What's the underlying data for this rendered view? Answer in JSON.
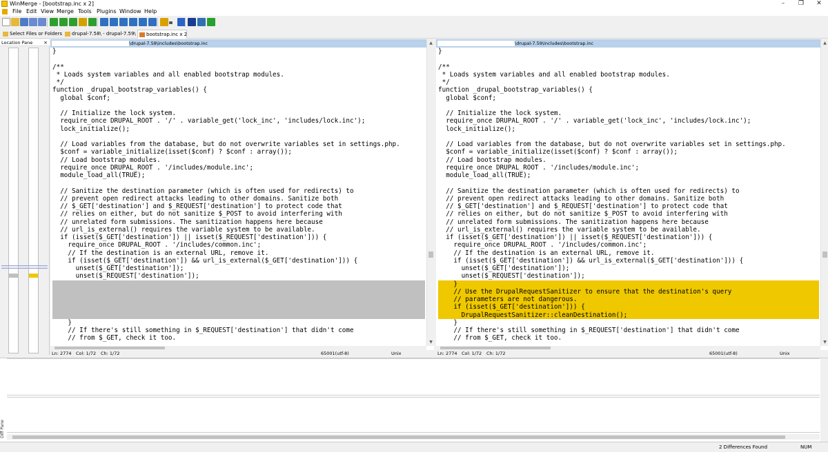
{
  "window": {
    "title": "WinMerge - [bootstrap.inc x 2]",
    "controls": [
      "–",
      "❐",
      "✕"
    ]
  },
  "menu": [
    "File",
    "Edit",
    "View",
    "Merge",
    "Tools",
    "Plugins",
    "Window",
    "Help"
  ],
  "toolbar": {
    "buttons": [
      {
        "icon": "new-icon",
        "color": "#ffffff"
      },
      {
        "icon": "open-icon",
        "color": "#e7b83b"
      },
      {
        "icon": "save-icon",
        "color": "#4d7cc4"
      },
      {
        "icon": "undo-icon",
        "color": "#6b8bd0"
      },
      {
        "icon": "redo-icon",
        "color": "#6b8bd0"
      },
      {
        "icon": "prev-diff-icon",
        "color": "#2f9e2f"
      },
      {
        "icon": "next-diff-icon",
        "color": "#2f9e2f"
      },
      {
        "icon": "first-diff-icon",
        "color": "#2f9e2f"
      },
      {
        "icon": "current-diff-icon",
        "color": "#d4a000"
      },
      {
        "icon": "last-diff-icon",
        "color": "#2f9e2f"
      },
      {
        "icon": "copy-right-icon",
        "color": "#3070c0"
      },
      {
        "icon": "copy-left-icon",
        "color": "#3070c0"
      },
      {
        "icon": "copy-right-advance-icon",
        "color": "#3070c0"
      },
      {
        "icon": "copy-left-advance-icon",
        "color": "#3070c0"
      },
      {
        "icon": "copy-all-right-icon",
        "color": "#3070c0"
      },
      {
        "icon": "copy-all-left-icon",
        "color": "#3070c0"
      },
      {
        "icon": "options-icon",
        "color": "#d9a100"
      },
      {
        "icon": "dropdown-icon",
        "color": "#555555"
      },
      {
        "icon": "compare-icon",
        "color": "#2a64c8"
      },
      {
        "icon": "merge-icon",
        "color": "#1a3d8f"
      },
      {
        "icon": "left-to-right-icon",
        "color": "#2f6fb5"
      },
      {
        "icon": "refresh-icon",
        "color": "#27a02c"
      }
    ]
  },
  "tabs": [
    {
      "label": "Select Files or Folders",
      "icon": "folder-select-icon"
    },
    {
      "label": "drupal-7.58\\ - drupal-7.59\\",
      "icon": "folder-compare-icon"
    },
    {
      "label": "bootstrap.inc x 2",
      "icon": "file-compare-icon"
    }
  ],
  "location_pane": {
    "title": "Location Pane",
    "close": "×"
  },
  "left": {
    "path": "\\drupal-7.58\\includes\\bootstrap.inc",
    "status": {
      "ln": "Ln: 2774",
      "col": "Col: 1/72",
      "ch": "Ch: 1/72",
      "encoding": "65001(utf-8)",
      "eol": "Unix"
    }
  },
  "right": {
    "path": "\\drupal-7.59\\includes\\bootstrap.inc",
    "status": {
      "ln": "Ln: 2774",
      "col": "Col: 1/72",
      "ch": "Ch: 1/72",
      "encoding": "65001(utf-8)",
      "eol": "Unix"
    }
  },
  "code_common_top": [
    "}",
    "",
    "/**",
    " * Loads system variables and all enabled bootstrap modules.",
    " */",
    "function _drupal_bootstrap_variables() {",
    "  global $conf;",
    "",
    "  // Initialize the lock system.",
    "  require_once DRUPAL_ROOT . '/' . variable_get('lock_inc', 'includes/lock.inc');",
    "  lock_initialize();",
    "",
    "  // Load variables from the database, but do not overwrite variables set in settings.php.",
    "  $conf = variable_initialize(isset($conf) ? $conf : array());",
    "  // Load bootstrap modules.",
    "  require_once DRUPAL_ROOT . '/includes/module.inc';",
    "  module_load_all(TRUE);",
    "",
    "  // Sanitize the destination parameter (which is often used for redirects) to",
    "  // prevent open redirect attacks leading to other domains. Sanitize both",
    "  // $_GET['destination'] and $_REQUEST['destination'] to protect code that",
    "  // relies on either, but do not sanitize $_POST to avoid interfering with",
    "  // unrelated form submissions. The sanitization happens here because",
    "  // url_is_external() requires the variable system to be available.",
    "  if (isset($_GET['destination']) || isset($_REQUEST['destination'])) {",
    "    require_once DRUPAL_ROOT . '/includes/common.inc';",
    "    // If the destination is an external URL, remove it.",
    "    if (isset($_GET['destination']) && url_is_external($_GET['destination'])) {",
    "      unset($_GET['destination']);",
    "      unset($_REQUEST['destination']);"
  ],
  "diff_right_lines": [
    "    }",
    "    // Use the DrupalRequestSanitizer to ensure that the destination's query",
    "    // parameters are not dangerous.",
    "    if (isset($_GET['destination'])) {",
    "      DrupalRequestSanitizer::cleanDestination();"
  ],
  "code_common_bottom": [
    "    }",
    "    // If there's still something in $_REQUEST['destination'] that didn't come",
    "    // from $_GET, check it too."
  ],
  "colors": {
    "diff_left": "#c0c0c0",
    "diff_right": "#efc800",
    "pathbar": "#b9d1ea"
  },
  "statusbar": {
    "differences": "2 Differences Found",
    "num": "NUM"
  },
  "diff_pane": {
    "label": "Diff Pane"
  }
}
